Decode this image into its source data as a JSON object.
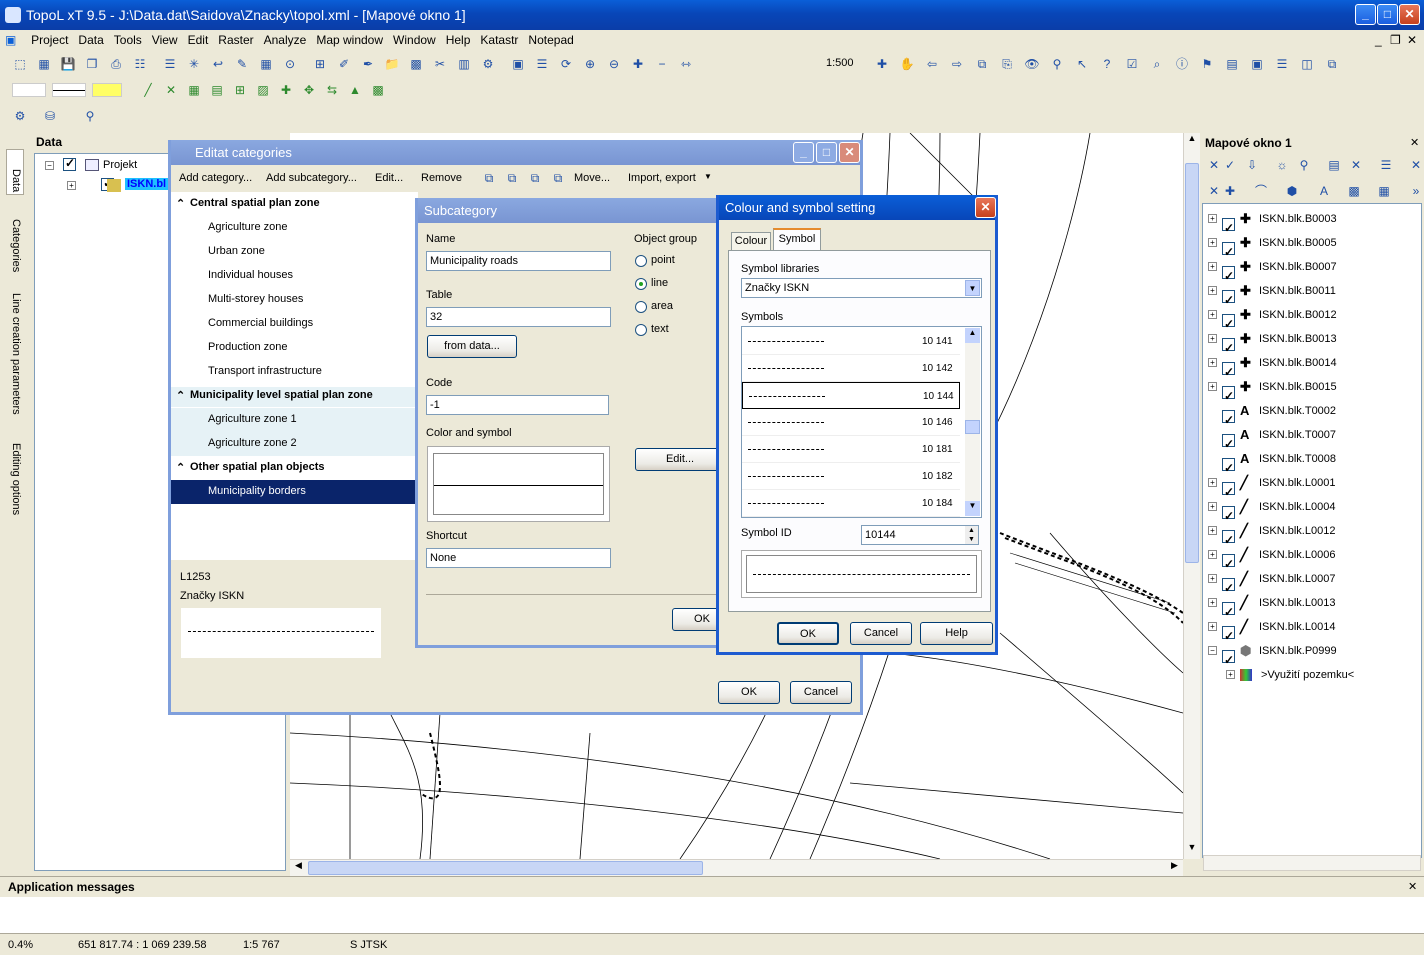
{
  "app": {
    "title": "TopoL xT 9.5 - J:\\Data.dat\\Saidova\\Znacky\\topol.xml - [Mapové okno 1]"
  },
  "menu": [
    "Project",
    "Data",
    "Tools",
    "View",
    "Edit",
    "Raster",
    "Analyze",
    "Map window",
    "Window",
    "Help",
    "Katastr",
    "Notepad"
  ],
  "toolbar": {
    "scale": "1:500"
  },
  "left_panel": {
    "title": "Data",
    "tree_root": "Projekt",
    "tree_child": "ISKN.bl",
    "side_tabs": [
      "Data",
      "Categories",
      "Line creation parameters",
      "Editing options"
    ]
  },
  "categories_dialog": {
    "title": "Editat categories",
    "toolbar": [
      "Add category...",
      "Add subcategory...",
      "Edit...",
      "Remove",
      "Move...",
      "Import, export"
    ],
    "groups": [
      {
        "name": "Central spatial plan zone",
        "items": [
          "Agriculture zone",
          "Urban zone",
          "Individual houses",
          "Multi-storey houses",
          "Commercial buildings",
          "Production zone",
          "Transport infrastructure"
        ]
      },
      {
        "name": "Municipality level spatial plan zone",
        "items": [
          "Agriculture zone 1",
          "Agriculture zone 2"
        ]
      },
      {
        "name": "Other spatial plan objects",
        "items": [
          "Municipality borders"
        ]
      }
    ],
    "info_code": "L1253",
    "info_lib": "Značky ISKN",
    "ok": "OK",
    "cancel": "Cancel"
  },
  "subcategory_dialog": {
    "title": "Subcategory",
    "name_label": "Name",
    "name_value": "Municipality roads",
    "table_label": "Table",
    "table_value": "32",
    "from_data": "from data...",
    "code_label": "Code",
    "code_value": "-1",
    "color_label": "Color and symbol",
    "shortcut_label": "Shortcut",
    "shortcut_value": "None",
    "object_group_label": "Object group",
    "groups": [
      "point",
      "line",
      "area",
      "text"
    ],
    "selected_group": "line",
    "edit": "Edit...",
    "ok": "OK"
  },
  "symbol_dialog": {
    "title": "Colour and symbol setting",
    "tabs": [
      "Colour",
      "Symbol"
    ],
    "active_tab": "Symbol",
    "libraries_label": "Symbol libraries",
    "library_value": "Značky ISKN",
    "symbols_label": "Symbols",
    "symbols": [
      "10 141",
      "10 142",
      "10 144",
      "10 146",
      "10 181",
      "10 182",
      "10 184"
    ],
    "selected_symbol": "10 144",
    "symbol_id_label": "Symbol ID",
    "symbol_id_value": "10144",
    "ok": "OK",
    "cancel": "Cancel",
    "help": "Help"
  },
  "right_panel": {
    "title": "Mapové okno 1",
    "layers": [
      {
        "name": "ISKN.blk.B0003",
        "icon": "cross"
      },
      {
        "name": "ISKN.blk.B0005",
        "icon": "cross"
      },
      {
        "name": "ISKN.blk.B0007",
        "icon": "cross"
      },
      {
        "name": "ISKN.blk.B0011",
        "icon": "cross"
      },
      {
        "name": "ISKN.blk.B0012",
        "icon": "cross"
      },
      {
        "name": "ISKN.blk.B0013",
        "icon": "cross"
      },
      {
        "name": "ISKN.blk.B0014",
        "icon": "cross"
      },
      {
        "name": "ISKN.blk.B0015",
        "icon": "cross"
      },
      {
        "name": "ISKN.blk.T0002",
        "icon": "text"
      },
      {
        "name": "ISKN.blk.T0007",
        "icon": "text"
      },
      {
        "name": "ISKN.blk.T0008",
        "icon": "text"
      },
      {
        "name": "ISKN.blk.L0001",
        "icon": "line"
      },
      {
        "name": "ISKN.blk.L0004",
        "icon": "line"
      },
      {
        "name": "ISKN.blk.L0012",
        "icon": "line"
      },
      {
        "name": "ISKN.blk.L0006",
        "icon": "line"
      },
      {
        "name": "ISKN.blk.L0007",
        "icon": "line"
      },
      {
        "name": "ISKN.blk.L0013",
        "icon": "line"
      },
      {
        "name": "ISKN.blk.L0014",
        "icon": "line"
      },
      {
        "name": "ISKN.blk.P0999",
        "icon": "poly"
      }
    ],
    "sublayer": ">Využití pozemku<"
  },
  "messages": {
    "title": "Application messages"
  },
  "status": {
    "zoom": "0.4%",
    "coords": "651 817.74 : 1 069 239.58",
    "scale": "1:5 767",
    "crs": "S JTSK"
  }
}
